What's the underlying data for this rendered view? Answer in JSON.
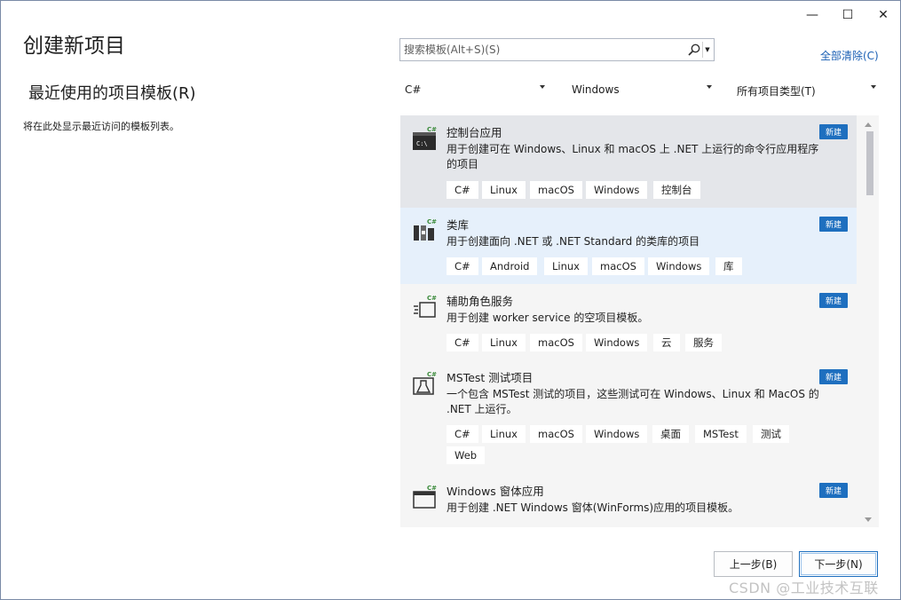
{
  "window": {
    "minimize_glyph": "—",
    "maximize_glyph": "☐",
    "close_glyph": "✕"
  },
  "left": {
    "title": "创建新项目",
    "recent_title": "最近使用的项目模板(R)",
    "recent_empty": "将在此处显示最近访问的模板列表。"
  },
  "search": {
    "placeholder": "搜索模板(Alt+S)(S)",
    "value": ""
  },
  "clear_all": "全部清除(C)",
  "filters": {
    "language": "C#",
    "platform": "Windows",
    "project_type": "所有项目类型(T)"
  },
  "templates": [
    {
      "name": "控制台应用",
      "desc": "用于创建可在 Windows、Linux 和 macOS 上 .NET 上运行的命令行应用程序的项目",
      "badge": "新建",
      "icon": "console-app-icon",
      "tags": [
        "C#",
        "Linux",
        "macOS",
        "Windows",
        "控制台"
      ]
    },
    {
      "name": "类库",
      "desc": "用于创建面向 .NET 或 .NET Standard 的类库的项目",
      "badge": "新建",
      "icon": "class-library-icon",
      "tags": [
        "C#",
        "Android",
        "Linux",
        "macOS",
        "Windows",
        "库"
      ]
    },
    {
      "name": "辅助角色服务",
      "desc": "用于创建 worker service 的空项目模板。",
      "badge": "新建",
      "icon": "worker-service-icon",
      "tags": [
        "C#",
        "Linux",
        "macOS",
        "Windows",
        "云",
        "服务"
      ]
    },
    {
      "name": "MSTest 测试项目",
      "desc": "一个包含 MSTest 测试的项目，这些测试可在 Windows、Linux 和 MacOS 的 .NET 上运行。",
      "badge": "新建",
      "icon": "mstest-icon",
      "tags": [
        "C#",
        "Linux",
        "macOS",
        "Windows",
        "桌面",
        "MSTest",
        "测试",
        "Web"
      ]
    },
    {
      "name": "Windows 窗体应用",
      "desc": "用于创建 .NET Windows 窗体(WinForms)应用的项目模板。",
      "badge": "新建",
      "icon": "winforms-app-icon",
      "tags": []
    }
  ],
  "buttons": {
    "back": "上一步(B)",
    "next": "下一步(N)"
  },
  "watermark": "CSDN @工业技术互联"
}
